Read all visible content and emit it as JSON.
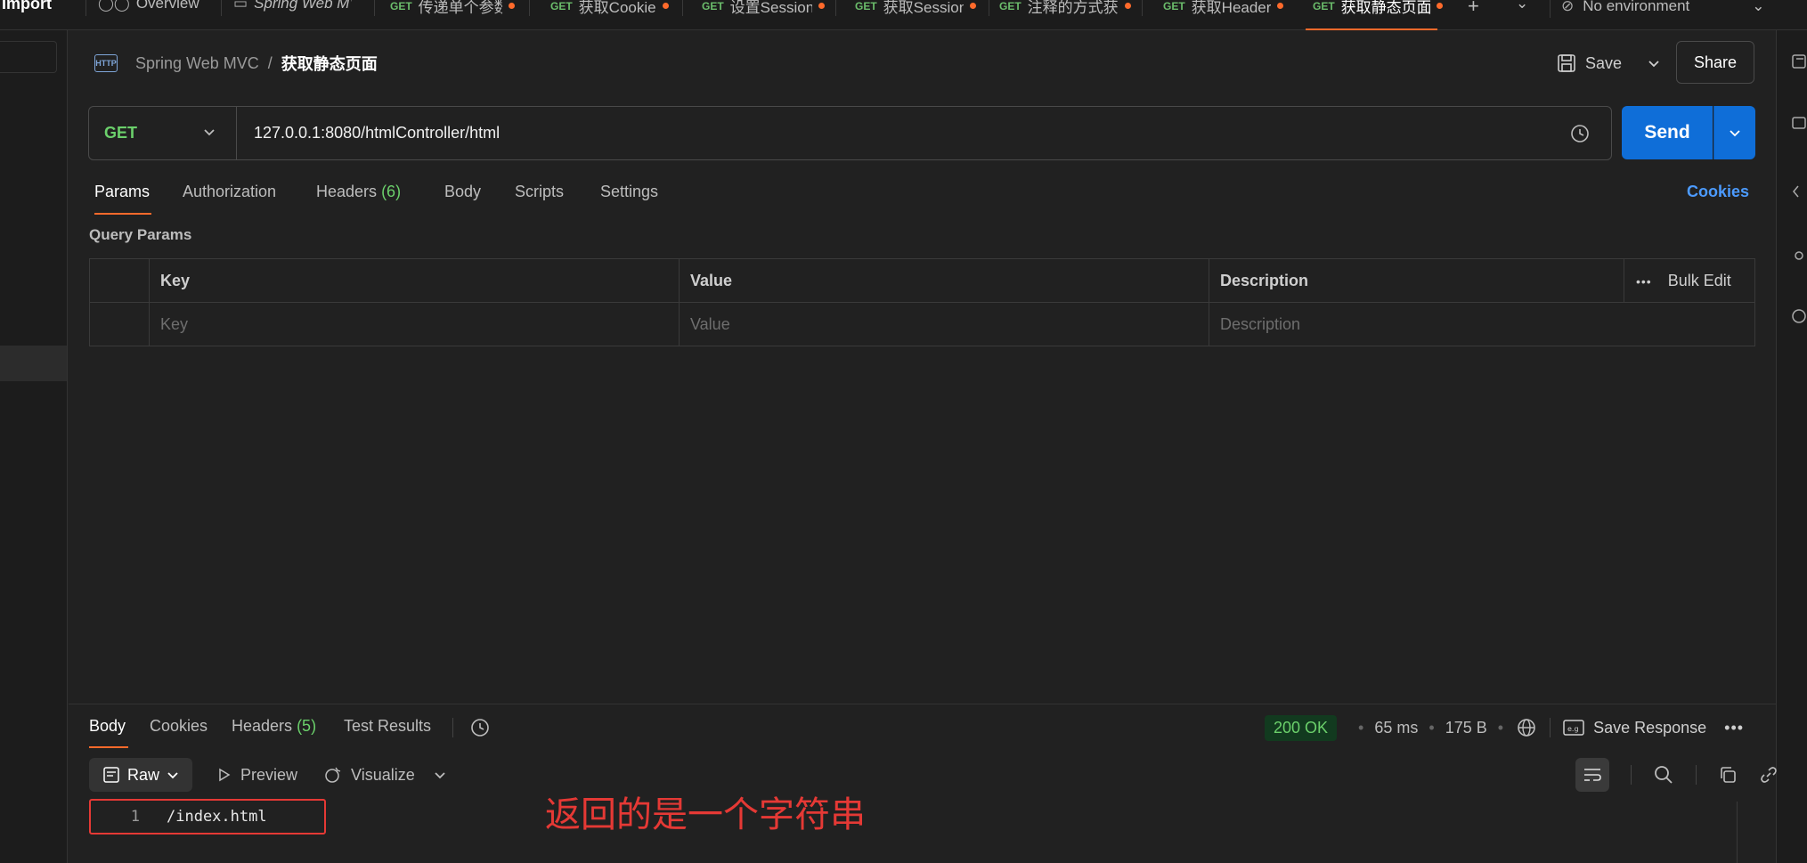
{
  "tabs": {
    "import_label": "Import",
    "items": [
      {
        "method": "",
        "label": "Overview"
      },
      {
        "method": "",
        "label": "Spring Web MVC"
      },
      {
        "method": "GET",
        "label": "传递单个参数"
      },
      {
        "method": "GET",
        "label": "获取Cookie"
      },
      {
        "method": "GET",
        "label": "设置Session"
      },
      {
        "method": "GET",
        "label": "获取Session"
      },
      {
        "method": "GET",
        "label": "注释的方式获"
      },
      {
        "method": "GET",
        "label": "获取Header"
      },
      {
        "method": "GET",
        "label": "获取静态页面"
      }
    ],
    "environment": "No environment"
  },
  "header": {
    "protocol_badge": "HTTP",
    "collection": "Spring Web MVC",
    "separator": "/",
    "request_name": "获取静态页面",
    "save_label": "Save",
    "share_label": "Share"
  },
  "request": {
    "method": "GET",
    "url": "127.0.0.1:8080/htmlController/html",
    "send_label": "Send",
    "tabs": [
      {
        "label": "Params",
        "count": ""
      },
      {
        "label": "Authorization",
        "count": ""
      },
      {
        "label": "Headers",
        "count": "(6)"
      },
      {
        "label": "Body",
        "count": ""
      },
      {
        "label": "Scripts",
        "count": ""
      },
      {
        "label": "Settings",
        "count": ""
      }
    ],
    "cookies_label": "Cookies"
  },
  "query_params": {
    "title": "Query Params",
    "columns": [
      "Key",
      "Value",
      "Description"
    ],
    "placeholders": [
      "Key",
      "Value",
      "Description"
    ],
    "bulk_edit_label": "Bulk Edit"
  },
  "response": {
    "tabs": [
      {
        "label": "Body",
        "count": ""
      },
      {
        "label": "Cookies",
        "count": ""
      },
      {
        "label": "Headers",
        "count": "(5)"
      },
      {
        "label": "Test Results",
        "count": ""
      }
    ],
    "status": "200 OK",
    "time": "65 ms",
    "size": "175 B",
    "save_response_label": "Save Response",
    "format": "Raw",
    "preview_label": "Preview",
    "visualize_label": "Visualize",
    "line_number": "1",
    "body": "/index.html"
  },
  "annotation": "返回的是一个字符串",
  "colors": {
    "accent": "#ff6a2b",
    "send": "#0f6ed8",
    "get_method": "#6bd06b",
    "link": "#4c9bff",
    "annotation_red": "#e53935"
  }
}
